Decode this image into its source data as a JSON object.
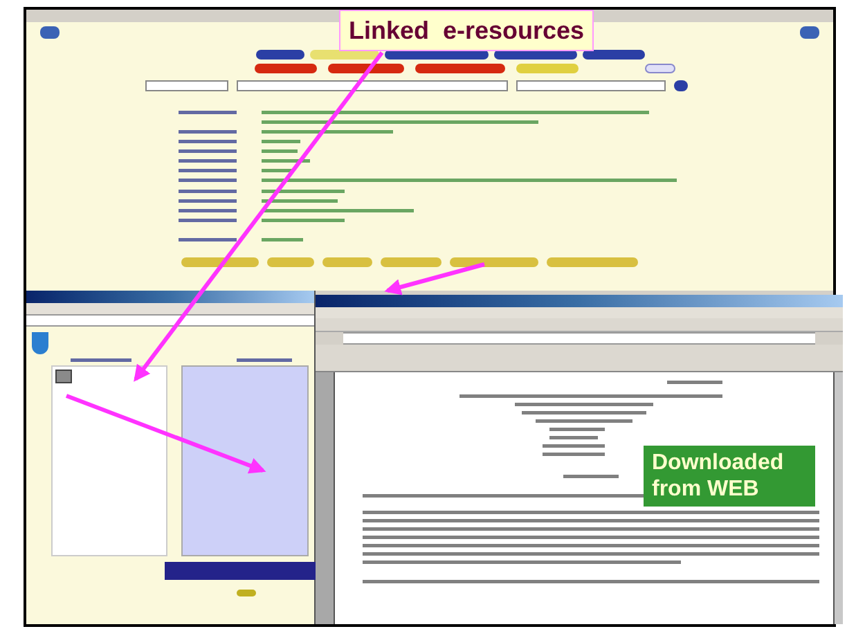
{
  "linked_label": {
    "text": "Linked  e-resources"
  },
  "downloaded_label": {
    "text": "Downloaded from WEB"
  }
}
